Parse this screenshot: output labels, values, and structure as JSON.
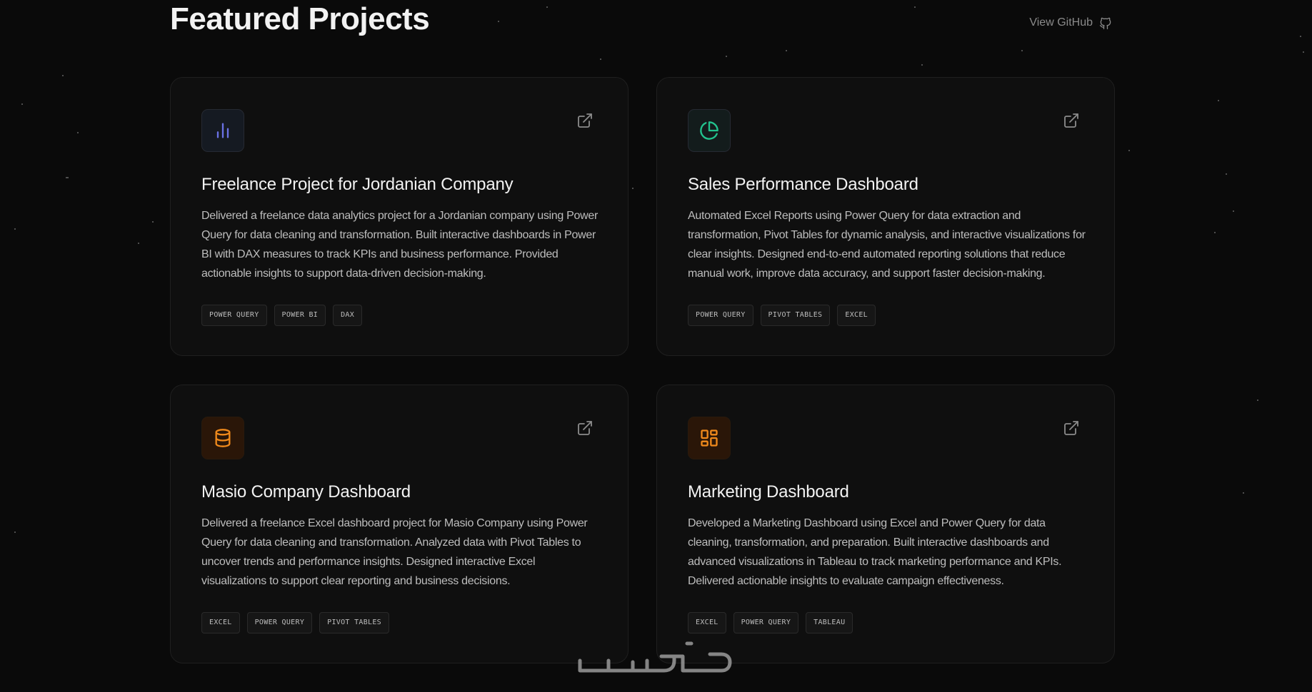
{
  "header": {
    "title": "Featured Projects",
    "github_label": "View GitHub"
  },
  "projects": [
    {
      "title": "Freelance Project for Jordanian Company",
      "description": "Delivered a freelance data analytics project for a Jordanian company using Power Query for data cleaning and transformation. Built interactive dashboards in Power BI with DAX measures to track KPIs and business performance. Provided actionable insights to support data-driven decision-making.",
      "icon": "bar-chart-icon",
      "icon_color": "#6b72e6",
      "tags": [
        "POWER QUERY",
        "POWER BI",
        "DAX"
      ]
    },
    {
      "title": "Sales Performance Dashboard",
      "description": "Automated Excel Reports using Power Query for data extraction and transformation, Pivot Tables for dynamic analysis, and interactive visualizations for clear insights. Designed end-to-end automated reporting solutions that reduce manual work, improve data accuracy, and support faster decision-making.",
      "icon": "pie-chart-icon",
      "icon_color": "#22c38e",
      "tags": [
        "POWER QUERY",
        "PIVOT TABLES",
        "EXCEL"
      ]
    },
    {
      "title": "Masio Company Dashboard",
      "description": "Delivered a freelance Excel dashboard project for Masio Company using Power Query for data cleaning and transformation. Analyzed data with Pivot Tables to uncover trends and performance insights. Designed interactive Excel visualizations to support clear reporting and business decisions.",
      "icon": "database-icon",
      "icon_color": "#f08a1c",
      "tags": [
        "EXCEL",
        "POWER QUERY",
        "PIVOT TABLES"
      ]
    },
    {
      "title": "Marketing Dashboard",
      "description": "Developed a Marketing Dashboard using Excel and Power Query for data cleaning, transformation, and preparation. Built interactive dashboards and advanced visualizations in Tableau to track marketing performance and KPIs. Delivered actionable insights to evaluate campaign effectiveness.",
      "icon": "dashboard-layout-icon",
      "icon_color": "#f08a1c",
      "tags": [
        "EXCEL",
        "POWER QUERY",
        "TABLEAU"
      ]
    }
  ],
  "watermark": "خمسات"
}
